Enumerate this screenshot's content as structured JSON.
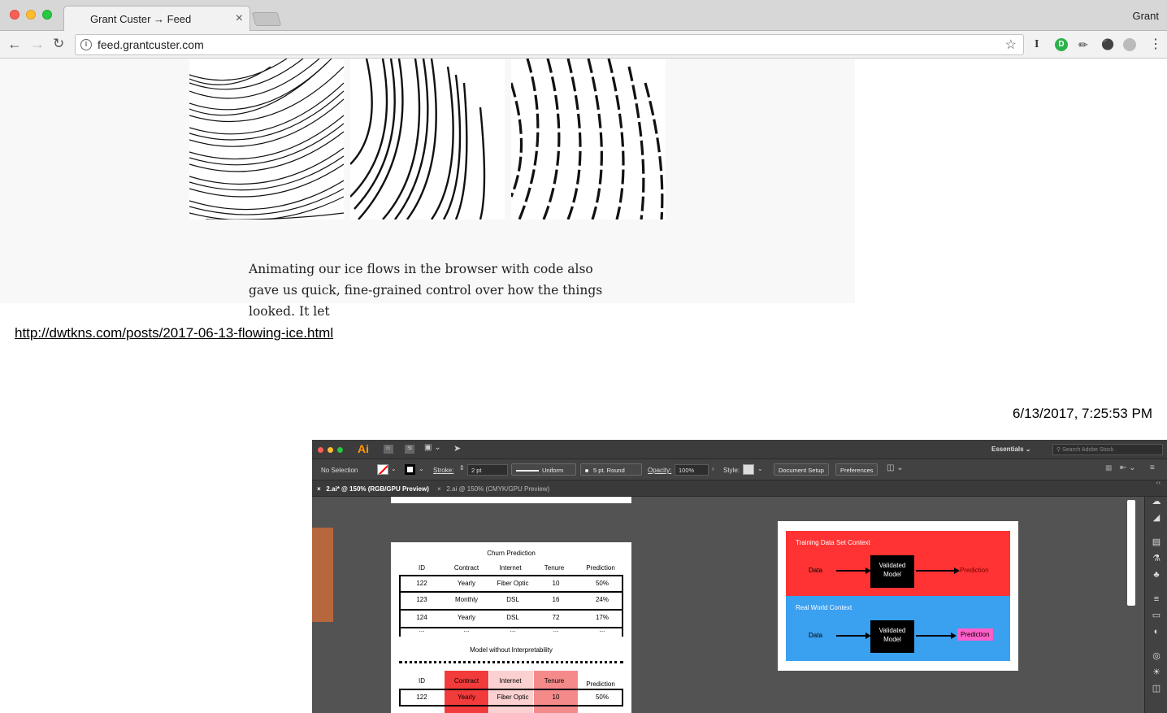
{
  "browser": {
    "tab_title": "Grant Custer → Feed",
    "profile": "Grant",
    "url": "feed.grantcuster.com",
    "tab_close": "×"
  },
  "post1": {
    "excerpt": "Animating our ice flows in the browser with code also gave us quick, fine-grained control over how the things looked. It let",
    "link": "http://dwtkns.com/posts/2017-06-13-flowing-ice.html"
  },
  "post2": {
    "timestamp": "6/13/2017, 7:25:53 PM"
  },
  "illustrator": {
    "app_badge": "Ai",
    "badge_br": "Br",
    "badge_st": "St",
    "workspace": "Essentials",
    "search_placeholder": "Search Adobe Stock",
    "selection": "No Selection",
    "stroke_label": "Stroke:",
    "stroke_value": "2 pt",
    "uniform": "Uniform",
    "brush": "5 pt. Round",
    "opacity_label": "Opacity:",
    "opacity_value": "100%",
    "style_label": "Style:",
    "document_setup": "Document Setup",
    "preferences": "Preferences",
    "tab1": "2.ai* @ 150% (RGB/GPU Preview)",
    "tab2": "2.ai @ 150% (CMYK/GPU Preview)",
    "tab_close": "×"
  },
  "churn": {
    "title": "Churn Prediction",
    "headers": [
      "ID",
      "Contract",
      "Internet",
      "Tenure",
      "Prediction"
    ],
    "rows": [
      [
        "122",
        "Yearly",
        "Fiber Optic",
        "10",
        "50%"
      ],
      [
        "123",
        "Monthly",
        "DSL",
        "16",
        "24%"
      ],
      [
        "124",
        "Yearly",
        "DSL",
        "72",
        "17%"
      ],
      [
        "...",
        "...",
        "...",
        "...",
        "..."
      ]
    ],
    "subtitle": "Model without Interpretability",
    "headers2": [
      "ID",
      "Contract",
      "Internet",
      "Tenure",
      "Prediction"
    ],
    "rows2": [
      [
        "122",
        "Yearly",
        "Fiber Optic",
        "10",
        "50%"
      ]
    ]
  },
  "diagram": {
    "training_label": "Training Data Set Context",
    "real_label": "Real World Context",
    "data": "Data",
    "model_line1": "Validated",
    "model_line2": "Model",
    "prediction": "Prediction",
    "colors": {
      "training": "#ff3333",
      "real": "#3aa0f0",
      "highlight": "#ff5fc8"
    }
  },
  "icons": {
    "back": "back-arrow-icon",
    "forward": "forward-arrow-icon",
    "reload": "reload-icon",
    "info": "info-icon",
    "star": "bookmark-star-icon",
    "menu": "kebab-menu-icon"
  }
}
